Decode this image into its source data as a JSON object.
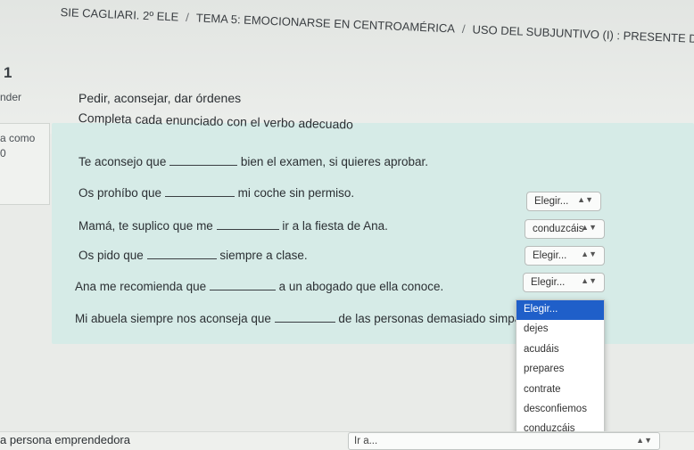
{
  "breadcrumb": {
    "items": [
      "SIE CAGLIARI. 2º ELE",
      "TEMA 5: EMOCIONARSE EN CENTROAMÉRICA",
      "USO DEL SUBJUNTIVO (I) : PRESENTE DE SUBJUNTIVO"
    ]
  },
  "question": {
    "number": "1",
    "left_labels": [
      "nder",
      "a como",
      "0"
    ],
    "title": "Pedir, aconsejar, dar órdenes",
    "instruction": "Completa cada enunciado con el verbo adecuado"
  },
  "sentences": [
    {
      "before": "Te aconsejo que",
      "after": "bien el examen, si quieres aprobar.",
      "selected": "Elegir..."
    },
    {
      "before": "Os prohíbo que",
      "after": "mi coche sin permiso.",
      "selected": "conduzcáis"
    },
    {
      "before": "Mamá, te suplico que me",
      "after": "ir a la fiesta de Ana.",
      "selected": "Elegir..."
    },
    {
      "before": "Os pido que",
      "after": "siempre a clase.",
      "selected": "Elegir..."
    },
    {
      "before": "Ana me recomienda que",
      "after": "a un abogado que ella conoce.",
      "selected": "Elegir..."
    },
    {
      "before": "Mi abuela siempre nos aconseja que",
      "after": "de las personas demasiado simpáticas."
    }
  ],
  "dropdown": {
    "options": [
      "Elegir...",
      "dejes",
      "acudáis",
      "prepares",
      "contrate",
      "desconfiemos",
      "conduzcáis"
    ],
    "highlighted_index": 0
  },
  "footer": {
    "left_text": "a persona emprendedora",
    "goto_label": "Ir a..."
  },
  "colors": {
    "panel": "#d6ebe7",
    "highlight": "#1f5fc9"
  }
}
